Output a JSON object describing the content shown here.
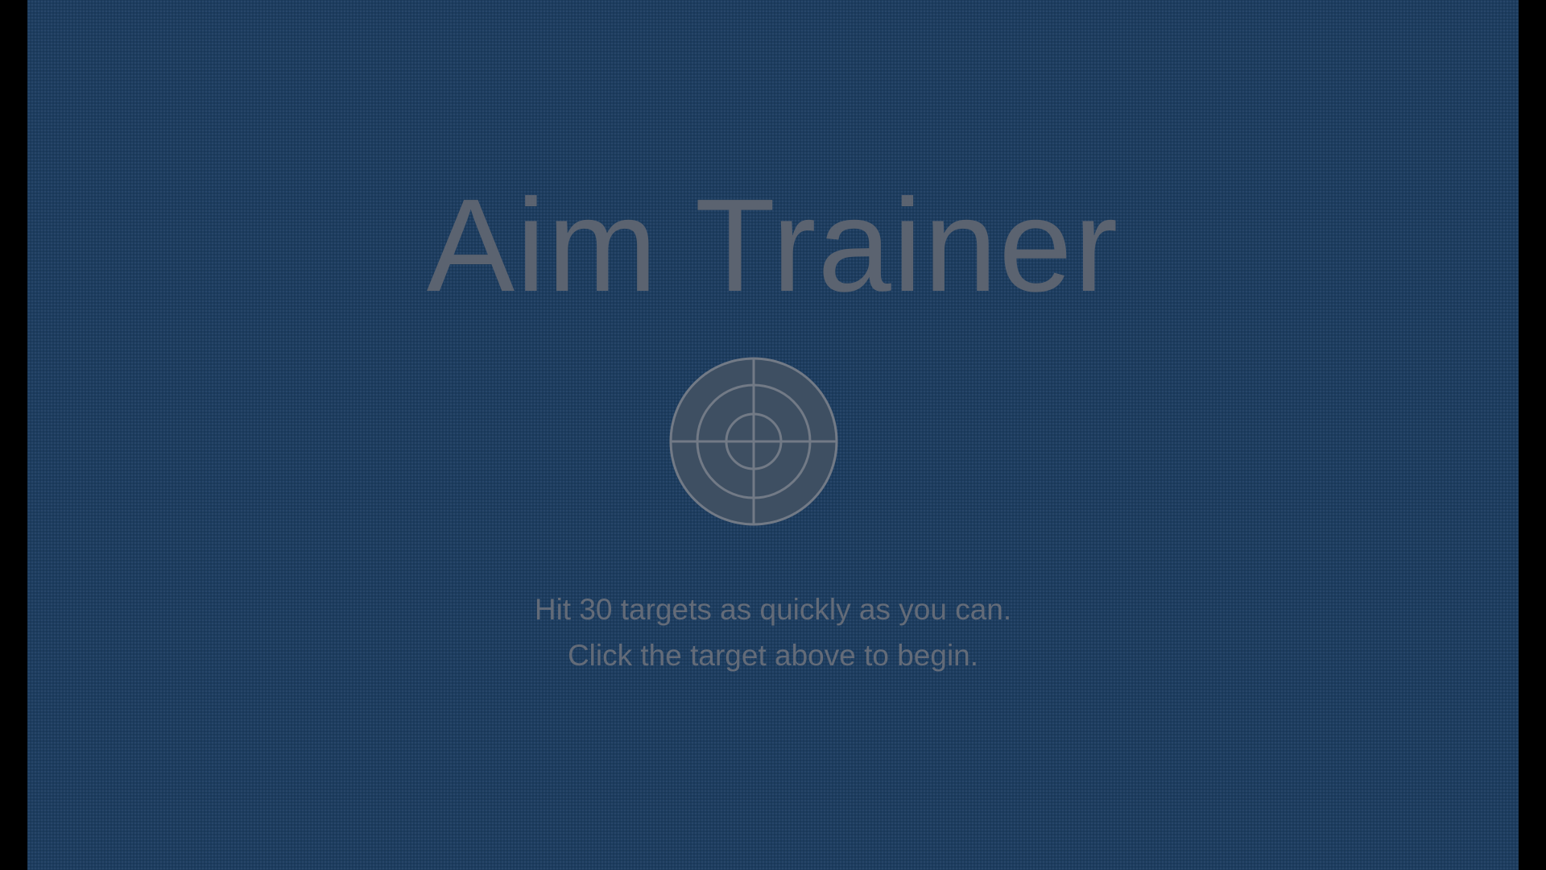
{
  "game": {
    "title": "Aim Trainer",
    "instructions": {
      "line1": "Hit 30 targets as quickly as you can.",
      "line2": "Click the target above to begin."
    },
    "target_icon": "crosshair-target-icon"
  },
  "colors": {
    "background": "#1d3d60",
    "text": "#5b6370",
    "target_fill": "#3e4f62",
    "target_stroke": "#727a86"
  }
}
